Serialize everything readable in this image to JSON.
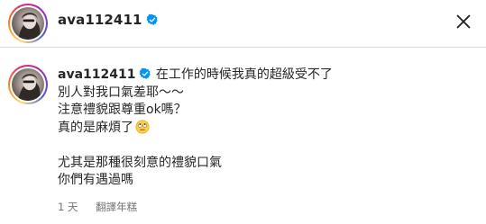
{
  "post_header": {
    "username": "ava112411",
    "verified_icon": "verified-badge-icon",
    "close_icon": "close-icon"
  },
  "comment": {
    "username": "ava112411",
    "lines": [
      "在工作的時候我真的超級受不了",
      "別人對我口氣差耶～～",
      "注意禮貌跟尊重ok嗎？",
      "真的是麻煩了",
      "",
      "尤其是那種很刻意的禮貌口氣",
      "你們有遇過嗎"
    ],
    "emoji": "rolling-eyes-face-icon",
    "time": "1 天",
    "translate_label": "翻譯年糕"
  },
  "colors": {
    "verified_blue": "#0095f6",
    "meta_gray": "#737373",
    "text": "#262626"
  }
}
